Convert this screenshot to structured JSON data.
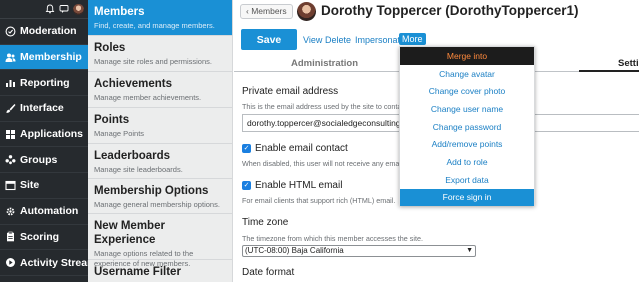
{
  "nav": {
    "items": [
      {
        "label": "Moderation",
        "icon": "shield-check-icon",
        "active": false
      },
      {
        "label": "Membership",
        "icon": "users-icon",
        "active": true
      },
      {
        "label": "Reporting",
        "icon": "bar-chart-icon",
        "active": false
      },
      {
        "label": "Interface",
        "icon": "brush-icon",
        "active": false
      },
      {
        "label": "Applications",
        "icon": "grid-icon",
        "active": false
      },
      {
        "label": "Groups",
        "icon": "groups-icon",
        "active": false
      },
      {
        "label": "Site",
        "icon": "browser-icon",
        "active": false
      },
      {
        "label": "Automation",
        "icon": "gear-icon",
        "active": false
      },
      {
        "label": "Scoring",
        "icon": "clipboard-icon",
        "active": false
      },
      {
        "label": "Activity Stream",
        "icon": "stream-icon",
        "active": false
      }
    ]
  },
  "sections": [
    {
      "title": "Members",
      "desc": "Find, create, and manage members.",
      "active": true
    },
    {
      "title": "Roles",
      "desc": "Manage site roles and permissions.",
      "active": false
    },
    {
      "title": "Achievements",
      "desc": "Manage member achievements.",
      "active": false
    },
    {
      "title": "Points",
      "desc": "Manage Points",
      "active": false
    },
    {
      "title": "Leaderboards",
      "desc": "Manage site leaderboards.",
      "active": false
    },
    {
      "title": "Membership Options",
      "desc": "Manage general membership options.",
      "active": false
    },
    {
      "title": "New Member Experience",
      "desc": "Manage options related to the experience of new members.",
      "active": false
    },
    {
      "title": "Username Filter",
      "desc": "",
      "active": false
    }
  ],
  "header": {
    "back_label": "Members",
    "title": "Dorothy Toppercer (DorothyToppercer1)"
  },
  "actions": {
    "save": "Save",
    "view": "View",
    "delete": "Delete",
    "impersonate": "Impersonate",
    "more": "More"
  },
  "tabs": {
    "administration": "Administration",
    "settings": "Setti"
  },
  "form": {
    "email_label": "Private email address",
    "email_hint": "This is the email address used by the site to contact this member.",
    "email_value": "dorothy.toppercer@socialedgeconsulting.com",
    "enable_email_label": "Enable email contact",
    "enable_email_hint": "When disabled, this user will not receive any emails from the site.",
    "enable_html_label": "Enable HTML email",
    "enable_html_hint": "For email clients that support rich (HTML) email.",
    "timezone_label": "Time zone",
    "timezone_hint": "The timezone from which this member accesses the site.",
    "timezone_value": "(UTC-08:00) Baja California",
    "date_format_label": "Date format"
  },
  "more_menu": {
    "items": [
      "Merge into",
      "Change avatar",
      "Change cover photo",
      "Change user name",
      "Change password",
      "Add/remove points",
      "Add to role",
      "Export data",
      "Force sign in"
    ]
  },
  "colors": {
    "accent": "#1a90d5",
    "nav_bg": "#262a2e",
    "merge_highlight": "#ff8a3d"
  }
}
